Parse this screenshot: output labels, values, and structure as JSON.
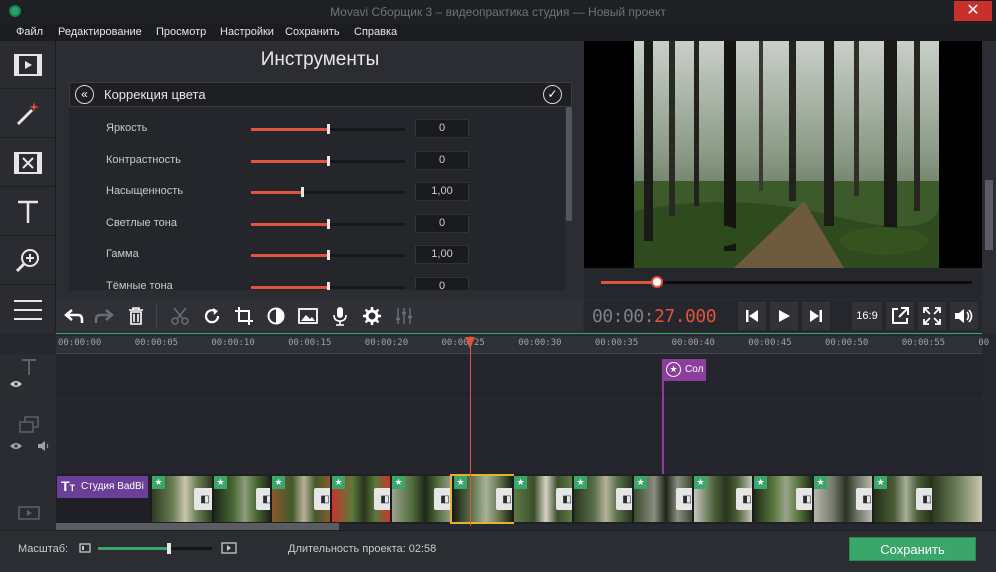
{
  "window": {
    "title": "Movavi Сборщик 3 – видеопрактика студия — Новый проект",
    "close_glyph": "✕"
  },
  "menu": {
    "items": [
      "Файл",
      "Редактирование",
      "Просмотр",
      "Настройки",
      "Сохранить",
      "Справка"
    ]
  },
  "left_toolbar": {
    "icons": [
      "film-import-icon",
      "magic-wand-icon",
      "transitions-icon",
      "text-icon",
      "zoom-icon",
      "list-icon"
    ]
  },
  "tools_panel": {
    "title": "Инструменты",
    "section_title": "Коррекция цвета",
    "sliders": [
      {
        "label": "Яркость",
        "value": "0",
        "level": 0.5
      },
      {
        "label": "Контрастность",
        "value": "0",
        "level": 0.5
      },
      {
        "label": "Насыщенность",
        "value": "1,00",
        "level": 0.33
      },
      {
        "label": "Светлые тона",
        "value": "0",
        "level": 0.5
      },
      {
        "label": "Гамма",
        "value": "1,00",
        "level": 0.5
      },
      {
        "label": "Тёмные тона",
        "value": "0",
        "level": 0.5
      }
    ]
  },
  "player": {
    "timecode_grey": "00:00:",
    "timecode_red": "27.000",
    "aspect_label": "16:9",
    "progress": 0.15
  },
  "timeline": {
    "ticks": [
      "00:00:00",
      "00:00:05",
      "00:00:10",
      "00:00:15",
      "00:00:20",
      "00:00:25",
      "00:00:30",
      "00:00:35",
      "00:00:40",
      "00:00:45",
      "00:00:50",
      "00:00:55",
      "00"
    ],
    "sticker_label": "Сол",
    "title_clip_label": "Студия BadBi"
  },
  "bottom": {
    "scale_label": "Масштаб:",
    "zoom_level": 0.62,
    "duration_label": "Длительность проекта: 02:58",
    "save_label": "Сохранить"
  },
  "colors": {
    "accent_red": "#e0533d",
    "accent_green": "#3aa66a",
    "sticker_purple": "#8b3e9b"
  }
}
